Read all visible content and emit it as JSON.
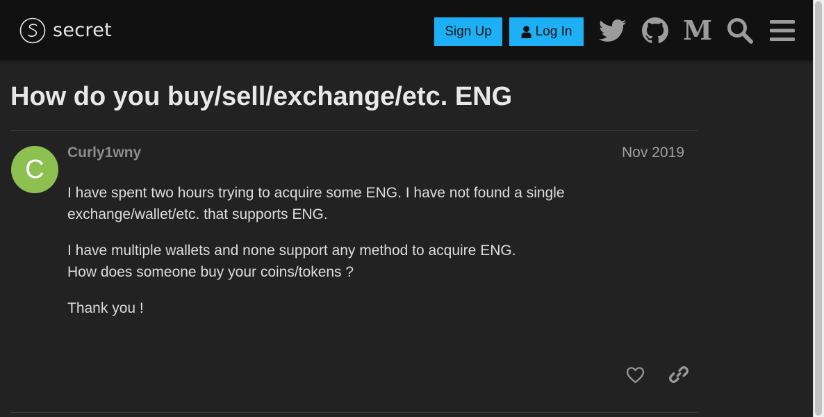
{
  "header": {
    "logo_text": "secret",
    "signup_label": "Sign Up",
    "login_label": "Log In",
    "icons": [
      "twitter-icon",
      "github-icon",
      "medium-icon",
      "search-icon",
      "hamburger-menu-icon"
    ],
    "medium_glyph": "M",
    "accent_color": "#1db0f5"
  },
  "topic": {
    "title": "How do you buy/sell/exchange/etc. ENG"
  },
  "post": {
    "avatar_letter": "C",
    "avatar_color": "#8cc152",
    "username": "Curly1wny",
    "date": "Nov 2019",
    "paragraphs": [
      [
        "I have spent two hours trying to acquire some ENG. I have not found a single",
        "exchange/wallet/etc. that supports ENG."
      ],
      [
        "I have multiple wallets and none support any method to acquire ENG.",
        "How does someone buy your coins/tokens ?"
      ],
      [
        "Thank you !"
      ]
    ],
    "actions": [
      "heart-icon",
      "link-icon"
    ]
  }
}
